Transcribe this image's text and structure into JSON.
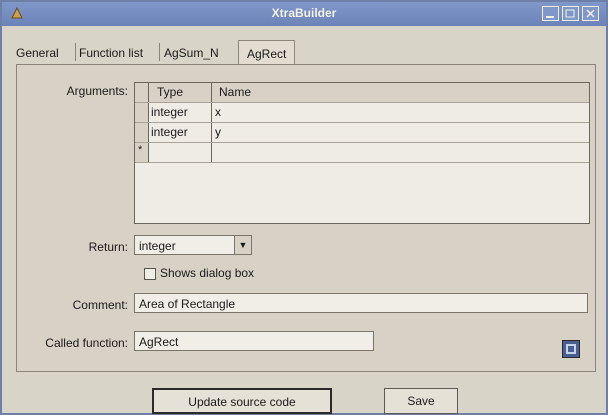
{
  "window": {
    "title": "XtraBuilder"
  },
  "tabs": [
    {
      "label": "General"
    },
    {
      "label": "Function list"
    },
    {
      "label": "AgSum_N"
    },
    {
      "label": "AgRect"
    }
  ],
  "form": {
    "arguments_label": "Arguments:",
    "columns": [
      "Type",
      "Name"
    ],
    "rows": [
      {
        "type": "integer",
        "name": "x"
      },
      {
        "type": "integer",
        "name": "y"
      },
      {
        "type": "",
        "name": ""
      }
    ],
    "new_row_marker": "*",
    "return_label": "Return:",
    "return_value": "integer",
    "shows_dialog_label": "Shows dialog box",
    "comment_label": "Comment:",
    "comment_value": "Area of Rectangle",
    "called_function_label": "Called function:",
    "called_function_value": "AgRect"
  },
  "buttons": {
    "update": "Update source code",
    "save": "Save"
  }
}
